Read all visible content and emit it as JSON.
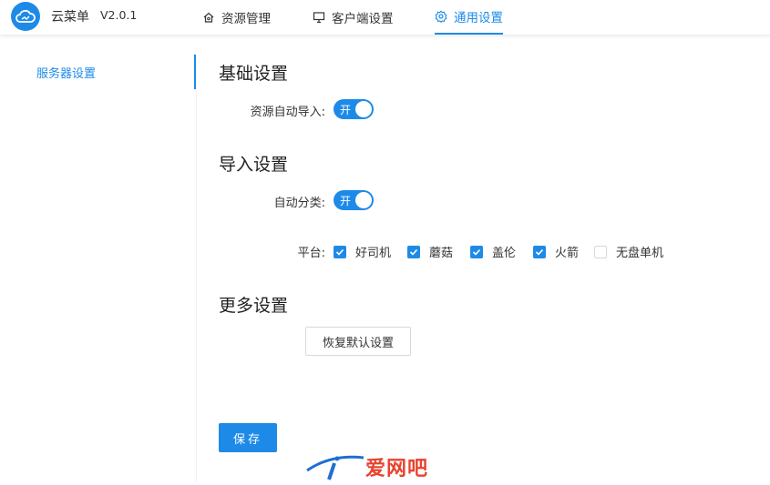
{
  "header": {
    "app_name": "云菜单",
    "version": "V2.0.1",
    "nav": [
      {
        "label": "资源管理",
        "icon": "home-icon"
      },
      {
        "label": "客户端设置",
        "icon": "monitor-icon"
      },
      {
        "label": "通用设置",
        "icon": "gear-icon",
        "active": true
      }
    ]
  },
  "sidebar": {
    "items": [
      {
        "label": "服务器设置",
        "active": true
      }
    ]
  },
  "main": {
    "basic": {
      "title": "基础设置",
      "auto_import_label": "资源自动导入:",
      "auto_import_value": "开"
    },
    "import": {
      "title": "导入设置",
      "auto_classify_label": "自动分类:",
      "auto_classify_value": "开",
      "platform_label": "平台:",
      "platforms": [
        {
          "label": "好司机",
          "checked": true
        },
        {
          "label": "蘑菇",
          "checked": true
        },
        {
          "label": "盖伦",
          "checked": true
        },
        {
          "label": "火箭",
          "checked": true
        },
        {
          "label": "无盘单机",
          "checked": false
        }
      ]
    },
    "more": {
      "title": "更多设置",
      "restore_button": "恢复默认设置"
    },
    "save_button": "保存"
  },
  "watermark": {
    "text": "爱网吧"
  },
  "colors": {
    "accent": "#1e8ae8",
    "watermark": "#e8432e"
  }
}
